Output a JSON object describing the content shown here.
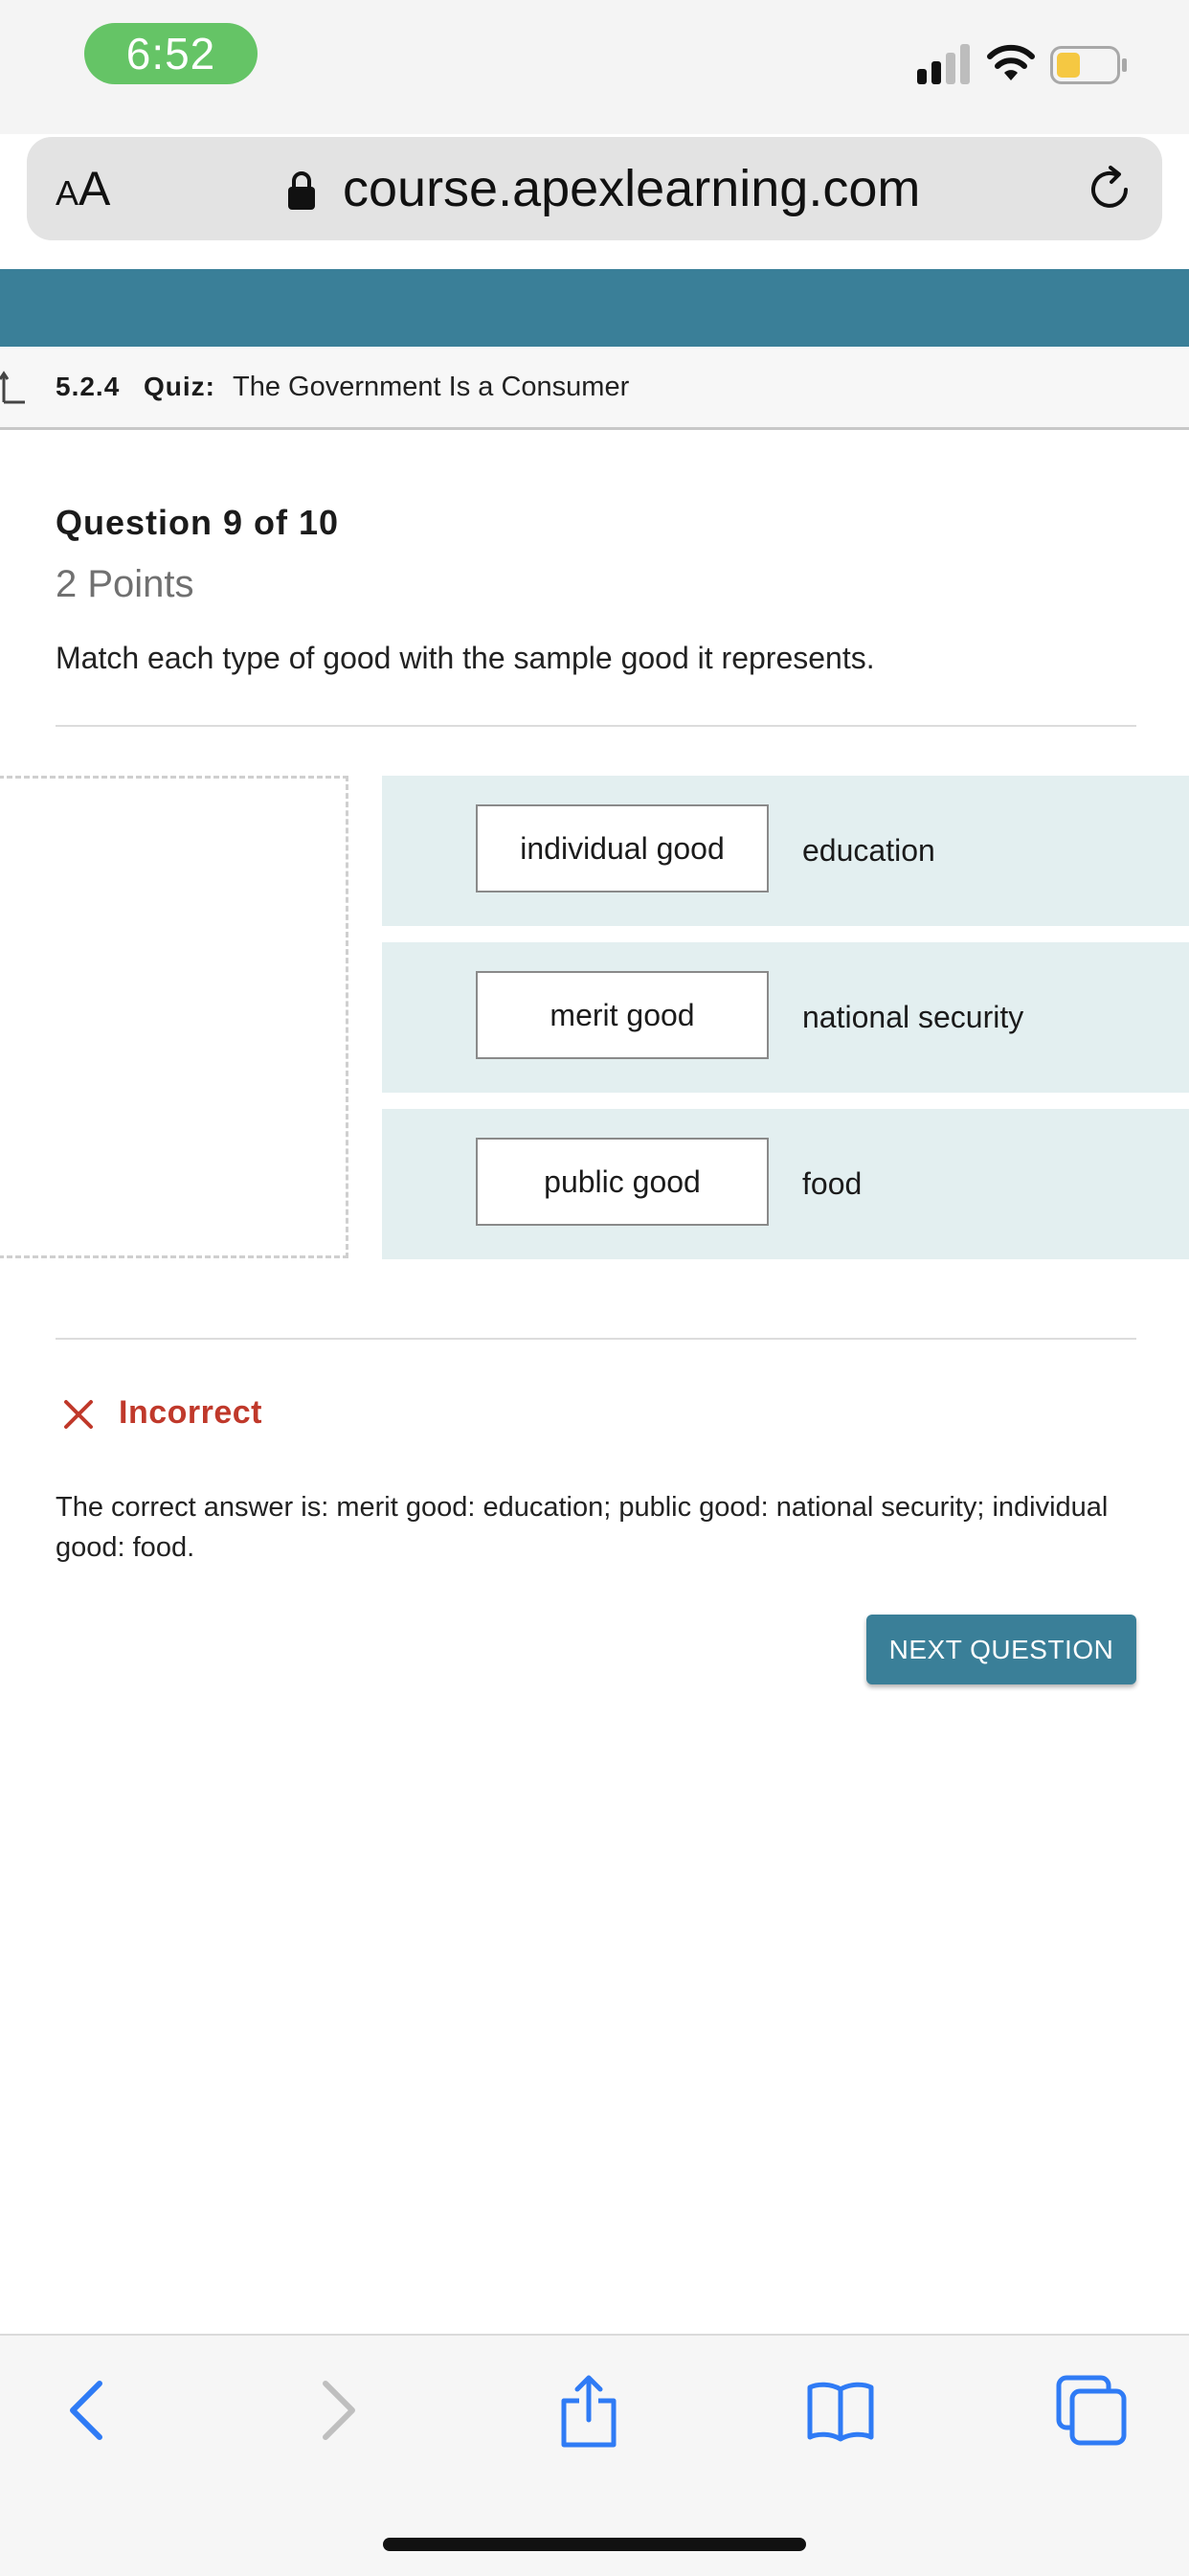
{
  "status_bar": {
    "time": "6:52"
  },
  "browser": {
    "aa_small": "A",
    "aa_large": "A",
    "url": "course.apexlearning.com"
  },
  "breadcrumb": {
    "number": "5.2.4",
    "type": "Quiz:",
    "title": "The Government Is a Consumer"
  },
  "question": {
    "title": "Question 9 of 10",
    "points": "2 Points",
    "prompt": "Match each type of good with the sample good it represents."
  },
  "matches": [
    {
      "answer": "individual good",
      "target": "education"
    },
    {
      "answer": "merit good",
      "target": "national security"
    },
    {
      "answer": "public good",
      "target": "food"
    }
  ],
  "result": {
    "label": "Incorrect",
    "correct_answer": "The correct answer is: merit good: education; public good: national security; individual good: food."
  },
  "next_button": "NEXT QUESTION",
  "colors": {
    "accent": "#3a7f98",
    "incorrect": "#c0392b",
    "row_bg": "#e3eff0",
    "time_pill": "#65c466"
  }
}
